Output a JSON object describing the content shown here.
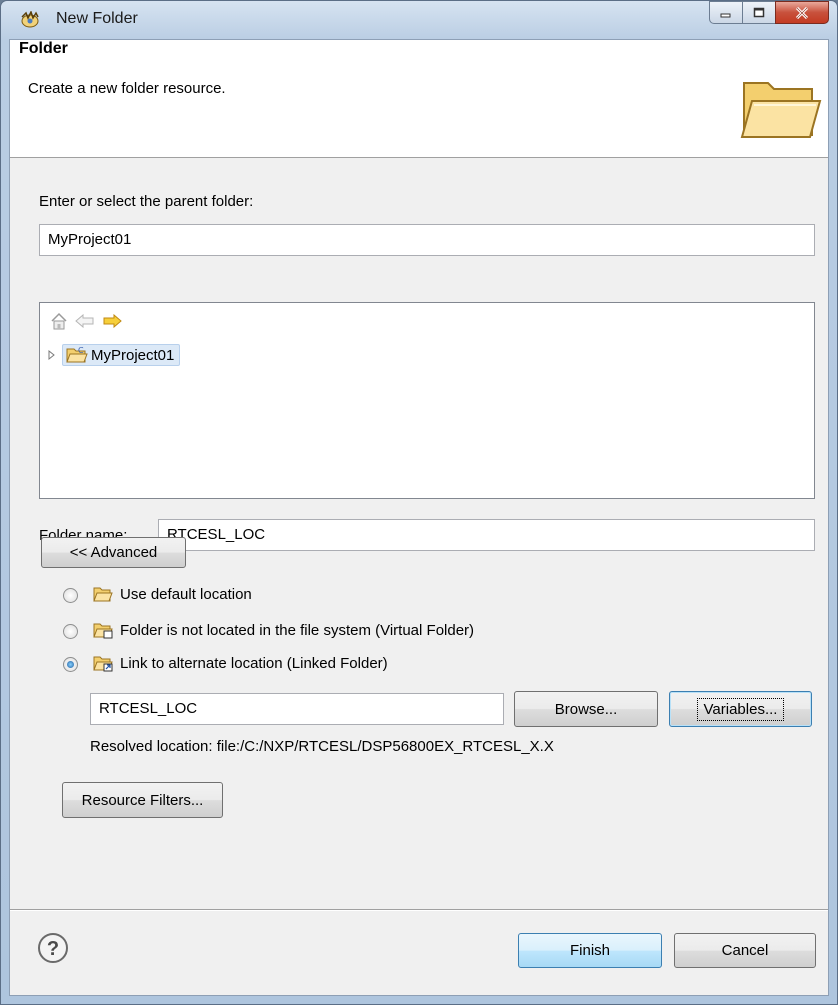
{
  "window": {
    "title": "New Folder"
  },
  "banner": {
    "title": "Folder",
    "description": "Create a new folder resource."
  },
  "parent": {
    "label": "Enter or select the parent folder:",
    "value": "MyProject01",
    "tree_items": [
      {
        "label": "MyProject01",
        "selected": true
      }
    ]
  },
  "folder_name": {
    "label": "Folder name:",
    "value": "RTCESL_LOC"
  },
  "advanced_button": "<< Advanced",
  "location_options": [
    {
      "label": "Use default location",
      "checked": false
    },
    {
      "label": "Folder is not located in the file system (Virtual Folder)",
      "checked": false
    },
    {
      "label": "Link to alternate location (Linked Folder)",
      "checked": true
    }
  ],
  "link": {
    "value": "RTCESL_LOC",
    "browse_label": "Browse...",
    "variables_label": "Variables...",
    "resolved_label": "Resolved location:",
    "resolved_value": "file:/C:/NXP/RTCESL/DSP56800EX_RTCESL_X.X"
  },
  "resource_filters_label": "Resource Filters...",
  "footer": {
    "finish_label": "Finish",
    "cancel_label": "Cancel"
  },
  "icons": {
    "app": "eclipse-icon",
    "banner": "open-folder-icon",
    "help": "help-icon",
    "home": "home-icon",
    "back": "back-arrow-icon",
    "forward": "forward-arrow-icon"
  },
  "colors": {
    "accent": "#3c7fb1",
    "folder": "#f5c75a",
    "selection": "#dce9f7"
  }
}
